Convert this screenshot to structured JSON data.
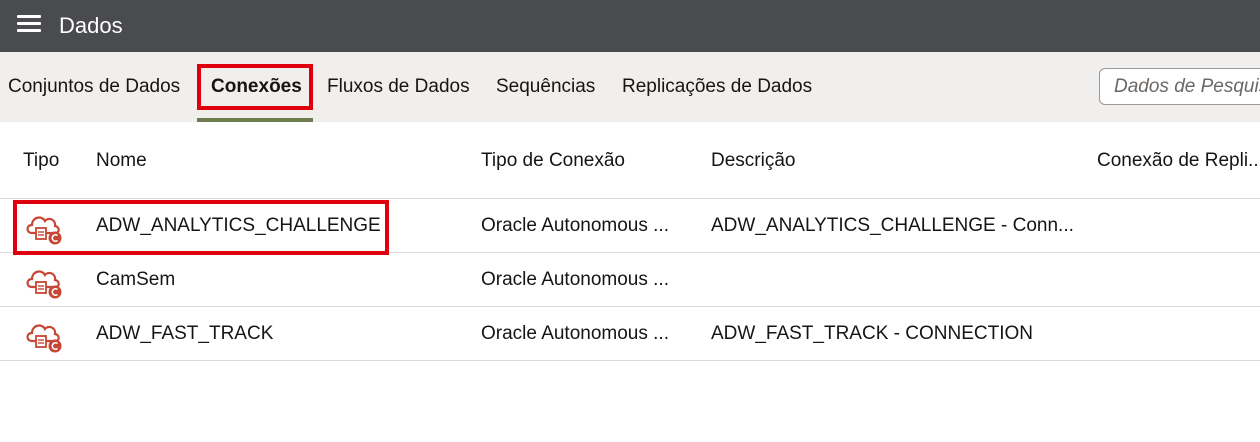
{
  "header": {
    "title": "Dados",
    "menu_icon": "hamburger-menu-icon"
  },
  "tabs": [
    {
      "label": "Conjuntos de Dados",
      "active": false
    },
    {
      "label": "Conexões",
      "active": true
    },
    {
      "label": "Fluxos de Dados",
      "active": false
    },
    {
      "label": "Sequências",
      "active": false
    },
    {
      "label": "Replicações de Dados",
      "active": false
    }
  ],
  "search": {
    "placeholder": "Dados de Pesquisa"
  },
  "table": {
    "columns": [
      "Tipo",
      "Nome",
      "Tipo de Conexão",
      "Descrição",
      "Conexão de Repli..."
    ],
    "rows": [
      {
        "icon": "cloud-database-connection-icon",
        "name": "ADW_ANALYTICS_CHALLENGE",
        "type": "Oracle Autonomous ...",
        "description": "ADW_ANALYTICS_CHALLENGE - Conn..."
      },
      {
        "icon": "cloud-database-connection-icon",
        "name": "CamSem",
        "type": "Oracle Autonomous ...",
        "description": ""
      },
      {
        "icon": "cloud-database-connection-icon",
        "name": "ADW_FAST_TRACK",
        "type": "Oracle Autonomous ...",
        "description": "ADW_FAST_TRACK - CONNECTION"
      }
    ]
  },
  "colors": {
    "header_bg": "#4a4b4f",
    "tabbar_bg": "#f1efed",
    "active_underline": "#6f7e4e",
    "highlight": "#e0000d",
    "icon_red": "#c74634"
  }
}
